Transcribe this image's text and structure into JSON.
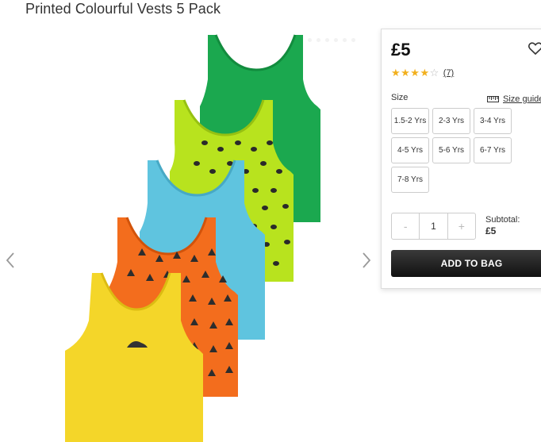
{
  "product": {
    "title": "Printed Colourful Vests 5 Pack",
    "price": "£5",
    "rating": {
      "value": 4,
      "max": 5,
      "count_label": "(7)"
    }
  },
  "gallery": {
    "prev_icon": "chevron-left-icon",
    "next_icon": "chevron-right-icon",
    "vest_colors": [
      "#1ba84f",
      "#b8e31e",
      "#5fc4df",
      "#f36d1d",
      "#f4d629"
    ]
  },
  "size": {
    "label": "Size",
    "guide_label": "Size guide",
    "options": [
      "1.5-2 Yrs",
      "2-3 Yrs",
      "3-4 Yrs",
      "4-5 Yrs",
      "5-6 Yrs",
      "6-7 Yrs",
      "7-8 Yrs"
    ]
  },
  "quantity": {
    "minus": "-",
    "value": "1",
    "plus": "+"
  },
  "subtotal": {
    "label": "Subtotal:",
    "amount": "£5"
  },
  "add_to_bag": "ADD TO BAG",
  "colors": {
    "star": "#f2b01e",
    "button": "#1a1a1a"
  }
}
